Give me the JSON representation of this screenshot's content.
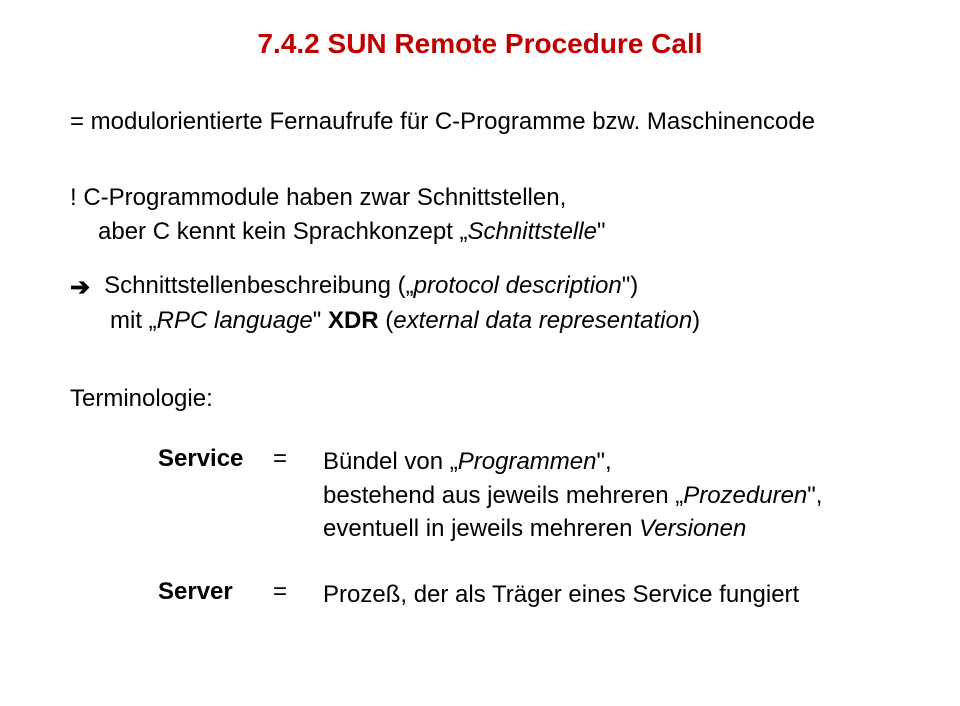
{
  "title": "7.4.2  SUN Remote Procedure Call",
  "eq_line": "=  modulorientierte Fernaufrufe für C-Programme bzw. Maschinencode",
  "bang_line": "!   C-Programmodule haben zwar Schnittstellen,",
  "aber_line_pre": "aber C kennt kein Sprachkonzept „",
  "aber_line_ital": "Schnittstelle",
  "aber_line_post": "\"",
  "arrow_sym": "➔",
  "arrow_line_pre": "Schnittstellenbeschreibung („",
  "arrow_line_ital": "protocol description",
  "arrow_line_post": "\")",
  "mit_pre": "mit „",
  "mit_ital": "RPC language",
  "mit_mid": "\"      ",
  "mit_bold": "XDR",
  "mit_paren_pre": " (",
  "mit_paren_ital": "external data representation",
  "mit_paren_post": ")",
  "terminologie": "Terminologie:",
  "defs": [
    {
      "label": "Service",
      "eq": "=",
      "body_parts": [
        {
          "t": "Bündel von „",
          "i": false
        },
        {
          "t": "Programmen",
          "i": true
        },
        {
          "t": "\",",
          "i": false
        },
        {
          "br": true
        },
        {
          "t": "bestehend aus jeweils mehreren „",
          "i": false
        },
        {
          "t": "Prozeduren",
          "i": true
        },
        {
          "t": "\",",
          "i": false
        },
        {
          "br": true
        },
        {
          "t": "eventuell in jeweils mehreren ",
          "i": false
        },
        {
          "t": "Versionen",
          "i": true
        }
      ]
    },
    {
      "label": "Server",
      "eq": "=",
      "body_parts": [
        {
          "t": "Prozeß, der als Träger eines Service fungiert",
          "i": false
        }
      ]
    }
  ]
}
